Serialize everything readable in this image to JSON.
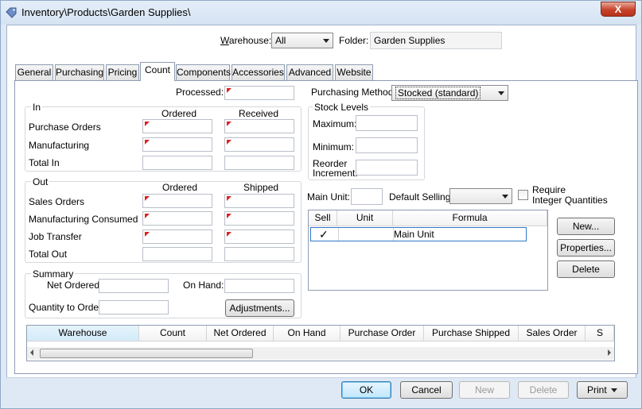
{
  "window": {
    "title": "Inventory\\Products\\Garden Supplies\\",
    "close_label": "X"
  },
  "header": {
    "warehouse_label": "Warehouse:",
    "warehouse_value": "All",
    "folder_label": "Folder:",
    "folder_value": "Garden Supplies"
  },
  "tabs": [
    {
      "label": "General"
    },
    {
      "label": "Purchasing"
    },
    {
      "label": "Pricing"
    },
    {
      "label": "Count",
      "active": true
    },
    {
      "label": "Components"
    },
    {
      "label": "Accessories"
    },
    {
      "label": "Advanced"
    },
    {
      "label": "Website"
    }
  ],
  "count": {
    "processed_label": "Processed:",
    "purchasing_method_label": "Purchasing Method:",
    "purchasing_method_value": "Stocked (standard)",
    "in": {
      "title": "In",
      "col_ordered": "Ordered",
      "col_received": "Received",
      "rows": [
        "Purchase Orders",
        "Manufacturing",
        "Total In"
      ]
    },
    "out": {
      "title": "Out",
      "col_ordered": "Ordered",
      "col_shipped": "Shipped",
      "rows": [
        "Sales Orders",
        "Manufacturing Consumed",
        "Job Transfer",
        "Total Out"
      ]
    },
    "summary": {
      "title": "Summary",
      "net_ordered_label": "Net Ordered:",
      "on_hand_label": "On Hand:",
      "quantity_to_order_label": "Quantity to Order:",
      "adjustments_button": "Adjustments..."
    },
    "stock_levels": {
      "title": "Stock Levels",
      "maximum_label": "Maximum:",
      "minimum_label": "Minimum:",
      "reorder_label_1": "Reorder",
      "reorder_label_2": "Increment:"
    },
    "units": {
      "main_unit_label": "Main Unit:",
      "default_selling_label": "Default Selling:",
      "require_integer_label_1": "Require",
      "require_integer_label_2": "Integer Quantities",
      "columns": [
        "Sell",
        "Unit",
        "Formula"
      ],
      "rows": [
        {
          "sell": "✓",
          "unit": "",
          "formula": "Main Unit"
        }
      ],
      "new_button": "New...",
      "properties_button": "Properties...",
      "delete_button": "Delete"
    },
    "warehouse_grid": {
      "columns": [
        "Warehouse",
        "Count",
        "Net Ordered",
        "On Hand",
        "Purchase Order",
        "Purchase Shipped",
        "Sales Order",
        "S"
      ]
    }
  },
  "footer": {
    "ok": "OK",
    "cancel": "Cancel",
    "new": "New",
    "delete": "Delete",
    "print": "Print"
  }
}
